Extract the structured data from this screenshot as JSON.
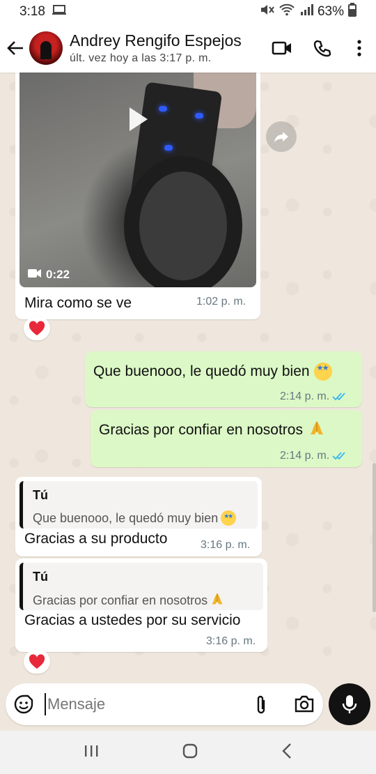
{
  "status_bar": {
    "time": "3:18",
    "battery": "63%"
  },
  "header": {
    "contact_name": "Andrey Rengifo Espejos",
    "last_seen": "últ. vez hoy a las 3:17 p. m."
  },
  "messages": [
    {
      "direction": "in",
      "type": "video",
      "duration": "0:22",
      "text": "Mira como se ve",
      "time": "1:02 p. m.",
      "reaction": "heart"
    },
    {
      "direction": "out",
      "text": "Que buenooo, le quedó muy bien",
      "emoji": "star-struck",
      "time": "2:14 p. m.",
      "status": "read"
    },
    {
      "direction": "out",
      "text": "Gracias por confiar en nosotros",
      "emoji": "folded-hands",
      "time": "2:14 p. m.",
      "status": "read"
    },
    {
      "direction": "in",
      "quote_author": "Tú",
      "quote_text": "Que buenooo, le quedó muy bien",
      "quote_emoji": "star-struck",
      "text": "Gracias a su producto",
      "time": "3:16 p. m."
    },
    {
      "direction": "in",
      "quote_author": "Tú",
      "quote_text": "Gracias por confiar en nosotros",
      "quote_emoji": "folded-hands",
      "text": "Gracias a ustedes por su servicio",
      "time": "3:16 p. m.",
      "reaction": "heart"
    }
  ],
  "composer": {
    "placeholder": "Mensaje"
  },
  "colors": {
    "outgoing_bubble": "#dcf8c6",
    "incoming_bubble": "#ffffff",
    "read_ticks": "#34b7f1",
    "chat_background": "#efe7dd"
  }
}
